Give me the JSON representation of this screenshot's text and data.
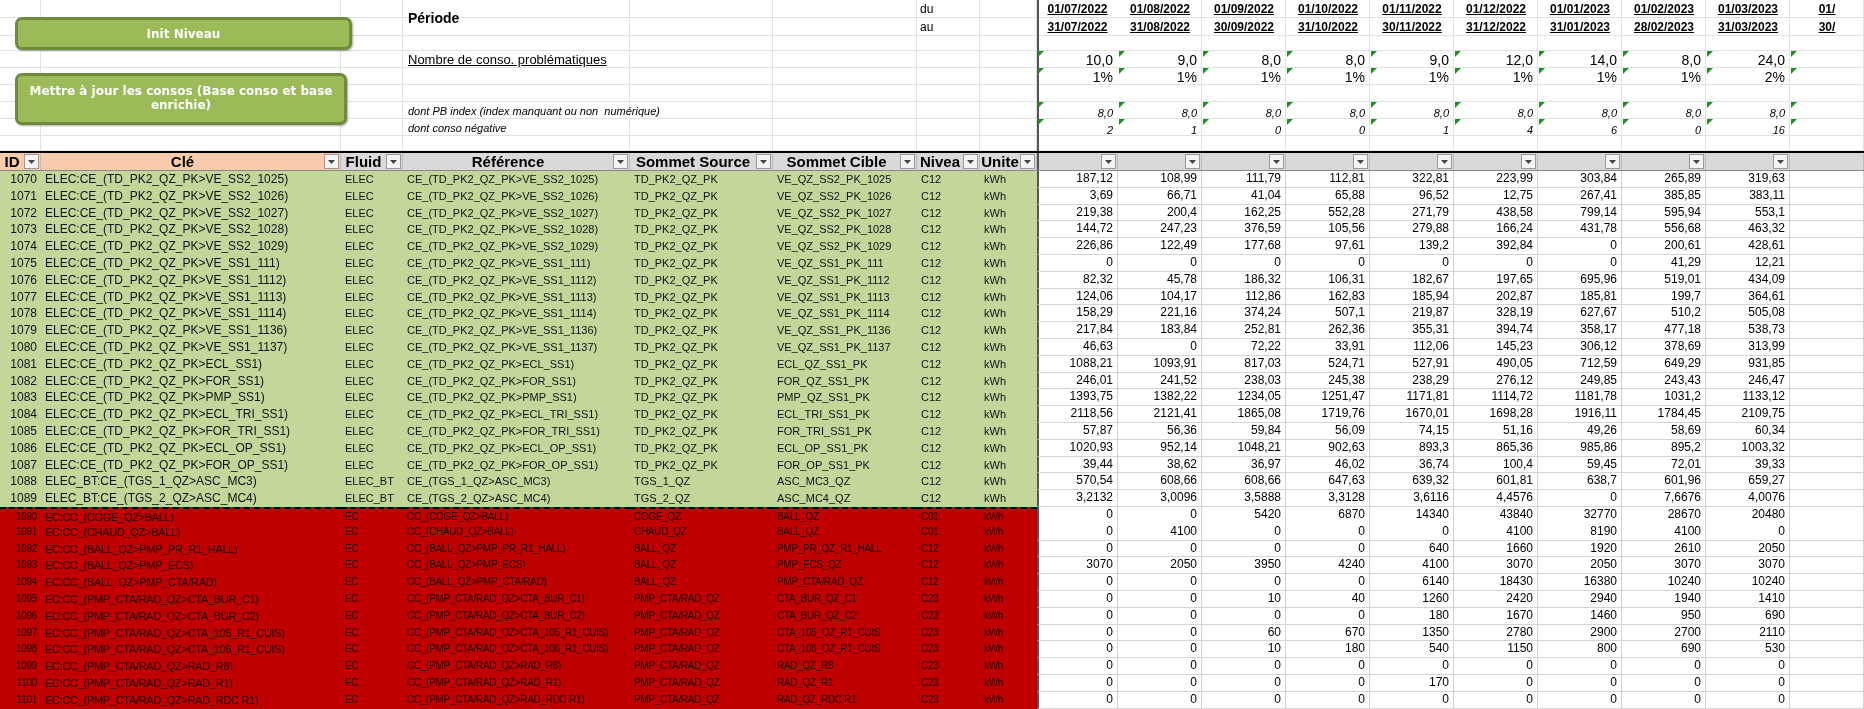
{
  "buttons": [
    {
      "label": "Init Niveau"
    },
    {
      "label": "Mettre à jour les consos (Base conso et base enrichie)"
    }
  ],
  "period": {
    "label": "Période",
    "from_label": "du",
    "to_label": "au"
  },
  "periods": [
    {
      "du": "01/07/2022",
      "au": "31/07/2022"
    },
    {
      "du": "01/08/2022",
      "au": "31/08/2022"
    },
    {
      "du": "01/09/2022",
      "au": "30/09/2022"
    },
    {
      "du": "01/10/2022",
      "au": "31/10/2022"
    },
    {
      "du": "01/11/2022",
      "au": "30/11/2022"
    },
    {
      "du": "01/12/2022",
      "au": "31/12/2022"
    },
    {
      "du": "01/01/2023",
      "au": "31/01/2023"
    },
    {
      "du": "01/02/2023",
      "au": "28/02/2023"
    },
    {
      "du": "01/03/2023",
      "au": "31/03/2023"
    },
    {
      "du": "01/",
      "au": "30/"
    }
  ],
  "summary_rows": [
    {
      "kind": "count",
      "label": "Nombre de conso. problématiques",
      "flagged": true,
      "values": [
        "10,0",
        "9,0",
        "8,0",
        "8,0",
        "9,0",
        "12,0",
        "14,0",
        "8,0",
        "24,0"
      ]
    },
    {
      "kind": "percent",
      "flagged": true,
      "values": [
        "1%",
        "1%",
        "1%",
        "1%",
        "1%",
        "1%",
        "1%",
        "1%",
        "2%"
      ]
    },
    {
      "kind": "detail",
      "label": "dont PB index (index manquant ou non  numérique)",
      "flagged": true,
      "values": [
        "8,0",
        "8,0",
        "8,0",
        "8,0",
        "8,0",
        "8,0",
        "8,0",
        "8,0",
        "8,0"
      ]
    },
    {
      "kind": "detail",
      "label": "dont conso négative",
      "flagged": true,
      "values": [
        "2",
        "1",
        "0",
        "0",
        "1",
        "4",
        "6",
        "0",
        "16"
      ]
    }
  ],
  "columns": [
    {
      "label": "ID",
      "color": "#f8cbad"
    },
    {
      "label": "Clé",
      "color": "#f8cbad"
    },
    {
      "label": "Fluid",
      "color": "#d9d9d9"
    },
    {
      "label": "Référence",
      "color": "#d9d9d9"
    },
    {
      "label": "Sommet Source",
      "color": "#d9d9d9"
    },
    {
      "label": "Sommet Cible",
      "color": "#d9d9d9"
    },
    {
      "label": "Nivea",
      "color": "#d9d9d9"
    },
    {
      "label": "Unite",
      "color": "#d9d9d9"
    }
  ],
  "row_groups": [
    {
      "color": "#c4d79b",
      "rows": [
        {
          "cells": [
            "1070",
            "ELEC:CE_(TD_PK2_QZ_PK>VE_SS2_1025)",
            "ELEC",
            "CE_(TD_PK2_QZ_PK>VE_SS2_1025)",
            "TD_PK2_QZ_PK",
            "VE_QZ_SS2_PK_1025",
            "C12",
            "kWh"
          ],
          "values": [
            "187,12",
            "108,99",
            "111,79",
            "112,81",
            "322,81",
            "223,99",
            "303,84",
            "265,89",
            "319,63"
          ]
        },
        {
          "cells": [
            "1071",
            "ELEC:CE_(TD_PK2_QZ_PK>VE_SS2_1026)",
            "ELEC",
            "CE_(TD_PK2_QZ_PK>VE_SS2_1026)",
            "TD_PK2_QZ_PK",
            "VE_QZ_SS2_PK_1026",
            "C12",
            "kWh"
          ],
          "values": [
            "3,69",
            "66,71",
            "41,04",
            "65,88",
            "96,52",
            "12,75",
            "267,41",
            "385,85",
            "383,11"
          ]
        },
        {
          "cells": [
            "1072",
            "ELEC:CE_(TD_PK2_QZ_PK>VE_SS2_1027)",
            "ELEC",
            "CE_(TD_PK2_QZ_PK>VE_SS2_1027)",
            "TD_PK2_QZ_PK",
            "VE_QZ_SS2_PK_1027",
            "C12",
            "kWh"
          ],
          "values": [
            "219,38",
            "200,4",
            "162,25",
            "552,28",
            "271,79",
            "438,58",
            "799,14",
            "595,94",
            "553,1"
          ]
        },
        {
          "cells": [
            "1073",
            "ELEC:CE_(TD_PK2_QZ_PK>VE_SS2_1028)",
            "ELEC",
            "CE_(TD_PK2_QZ_PK>VE_SS2_1028)",
            "TD_PK2_QZ_PK",
            "VE_QZ_SS2_PK_1028",
            "C12",
            "kWh"
          ],
          "values": [
            "144,72",
            "247,23",
            "376,59",
            "105,56",
            "279,88",
            "166,24",
            "431,78",
            "556,68",
            "463,32"
          ]
        },
        {
          "cells": [
            "1074",
            "ELEC:CE_(TD_PK2_QZ_PK>VE_SS2_1029)",
            "ELEC",
            "CE_(TD_PK2_QZ_PK>VE_SS2_1029)",
            "TD_PK2_QZ_PK",
            "VE_QZ_SS2_PK_1029",
            "C12",
            "kWh"
          ],
          "values": [
            "226,86",
            "122,49",
            "177,68",
            "97,61",
            "139,2",
            "392,84",
            "0",
            "200,61",
            "428,61"
          ]
        },
        {
          "cells": [
            "1075",
            "ELEC:CE_(TD_PK2_QZ_PK>VE_SS1_111)",
            "ELEC",
            "CE_(TD_PK2_QZ_PK>VE_SS1_111)",
            "TD_PK2_QZ_PK",
            "VE_QZ_SS1_PK_111",
            "C12",
            "kWh"
          ],
          "values": [
            "0",
            "0",
            "0",
            "0",
            "0",
            "0",
            "0",
            "41,29",
            "12,21"
          ]
        },
        {
          "cells": [
            "1076",
            "ELEC:CE_(TD_PK2_QZ_PK>VE_SS1_1112)",
            "ELEC",
            "CE_(TD_PK2_QZ_PK>VE_SS1_1112)",
            "TD_PK2_QZ_PK",
            "VE_QZ_SS1_PK_1112",
            "C12",
            "kWh"
          ],
          "values": [
            "82,32",
            "45,78",
            "186,32",
            "106,31",
            "182,67",
            "197,65",
            "695,96",
            "519,01",
            "434,09"
          ]
        },
        {
          "cells": [
            "1077",
            "ELEC:CE_(TD_PK2_QZ_PK>VE_SS1_1113)",
            "ELEC",
            "CE_(TD_PK2_QZ_PK>VE_SS1_1113)",
            "TD_PK2_QZ_PK",
            "VE_QZ_SS1_PK_1113",
            "C12",
            "kWh"
          ],
          "values": [
            "124,06",
            "104,17",
            "112,86",
            "162,83",
            "185,94",
            "202,87",
            "185,81",
            "199,7",
            "364,61"
          ]
        },
        {
          "cells": [
            "1078",
            "ELEC:CE_(TD_PK2_QZ_PK>VE_SS1_1114)",
            "ELEC",
            "CE_(TD_PK2_QZ_PK>VE_SS1_1114)",
            "TD_PK2_QZ_PK",
            "VE_QZ_SS1_PK_1114",
            "C12",
            "kWh"
          ],
          "values": [
            "158,29",
            "221,16",
            "374,24",
            "507,1",
            "219,87",
            "328,19",
            "627,67",
            "510,2",
            "505,08"
          ]
        },
        {
          "cells": [
            "1079",
            "ELEC:CE_(TD_PK2_QZ_PK>VE_SS1_1136)",
            "ELEC",
            "CE_(TD_PK2_QZ_PK>VE_SS1_1136)",
            "TD_PK2_QZ_PK",
            "VE_QZ_SS1_PK_1136",
            "C12",
            "kWh"
          ],
          "values": [
            "217,84",
            "183,84",
            "252,81",
            "262,36",
            "355,31",
            "394,74",
            "358,17",
            "477,18",
            "538,73"
          ]
        },
        {
          "cells": [
            "1080",
            "ELEC:CE_(TD_PK2_QZ_PK>VE_SS1_1137)",
            "ELEC",
            "CE_(TD_PK2_QZ_PK>VE_SS1_1137)",
            "TD_PK2_QZ_PK",
            "VE_QZ_SS1_PK_1137",
            "C12",
            "kWh"
          ],
          "values": [
            "46,63",
            "0",
            "72,22",
            "33,91",
            "112,06",
            "145,23",
            "306,12",
            "378,69",
            "313,99"
          ]
        },
        {
          "cells": [
            "1081",
            "ELEC:CE_(TD_PK2_QZ_PK>ECL_SS1)",
            "ELEC",
            "CE_(TD_PK2_QZ_PK>ECL_SS1)",
            "TD_PK2_QZ_PK",
            "ECL_QZ_SS1_PK",
            "C12",
            "kWh"
          ],
          "values": [
            "1088,21",
            "1093,91",
            "817,03",
            "524,71",
            "527,91",
            "490,05",
            "712,59",
            "649,29",
            "931,85"
          ]
        },
        {
          "cells": [
            "1082",
            "ELEC:CE_(TD_PK2_QZ_PK>FOR_SS1)",
            "ELEC",
            "CE_(TD_PK2_QZ_PK>FOR_SS1)",
            "TD_PK2_QZ_PK",
            "FOR_QZ_SS1_PK",
            "C12",
            "kWh"
          ],
          "values": [
            "246,01",
            "241,52",
            "238,03",
            "245,38",
            "238,29",
            "276,12",
            "249,85",
            "243,43",
            "246,47"
          ]
        },
        {
          "cells": [
            "1083",
            "ELEC:CE_(TD_PK2_QZ_PK>PMP_SS1)",
            "ELEC",
            "CE_(TD_PK2_QZ_PK>PMP_SS1)",
            "TD_PK2_QZ_PK",
            "PMP_QZ_SS1_PK",
            "C12",
            "kWh"
          ],
          "values": [
            "1393,75",
            "1382,22",
            "1234,05",
            "1251,47",
            "1171,81",
            "1114,72",
            "1181,78",
            "1031,2",
            "1133,12"
          ]
        },
        {
          "cells": [
            "1084",
            "ELEC:CE_(TD_PK2_QZ_PK>ECL_TRI_SS1)",
            "ELEC",
            "CE_(TD_PK2_QZ_PK>ECL_TRI_SS1)",
            "TD_PK2_QZ_PK",
            "ECL_TRI_SS1_PK",
            "C12",
            "kWh"
          ],
          "values": [
            "2118,56",
            "2121,41",
            "1865,08",
            "1719,76",
            "1670,01",
            "1698,28",
            "1916,11",
            "1784,45",
            "2109,75"
          ]
        },
        {
          "cells": [
            "1085",
            "ELEC:CE_(TD_PK2_QZ_PK>FOR_TRI_SS1)",
            "ELEC",
            "CE_(TD_PK2_QZ_PK>FOR_TRI_SS1)",
            "TD_PK2_QZ_PK",
            "FOR_TRI_SS1_PK",
            "C12",
            "kWh"
          ],
          "values": [
            "57,87",
            "56,36",
            "59,84",
            "56,09",
            "74,15",
            "51,16",
            "49,26",
            "58,69",
            "60,34"
          ]
        },
        {
          "cells": [
            "1086",
            "ELEC:CE_(TD_PK2_QZ_PK>ECL_OP_SS1)",
            "ELEC",
            "CE_(TD_PK2_QZ_PK>ECL_OP_SS1)",
            "TD_PK2_QZ_PK",
            "ECL_OP_SS1_PK",
            "C12",
            "kWh"
          ],
          "values": [
            "1020,93",
            "952,14",
            "1048,21",
            "902,63",
            "893,3",
            "865,36",
            "985,86",
            "895,2",
            "1003,32"
          ]
        },
        {
          "cells": [
            "1087",
            "ELEC:CE_(TD_PK2_QZ_PK>FOR_OP_SS1)",
            "ELEC",
            "CE_(TD_PK2_QZ_PK>FOR_OP_SS1)",
            "TD_PK2_QZ_PK",
            "FOR_OP_SS1_PK",
            "C12",
            "kWh"
          ],
          "values": [
            "39,44",
            "38,62",
            "36,97",
            "46,02",
            "36,74",
            "100,4",
            "59,45",
            "72,01",
            "39,33"
          ]
        },
        {
          "cells": [
            "1088",
            "ELEC_BT:CE_(TGS_1_QZ>ASC_MC3)",
            "ELEC_BT",
            "CE_(TGS_1_QZ>ASC_MC3)",
            "TGS_1_QZ",
            "ASC_MC3_QZ",
            "C12",
            "kWh"
          ],
          "values": [
            "570,54",
            "608,66",
            "608,66",
            "647,63",
            "639,32",
            "601,81",
            "638,7",
            "601,96",
            "659,27"
          ]
        },
        {
          "cells": [
            "1089",
            "ELEC_BT:CE_(TGS_2_QZ>ASC_MC4)",
            "ELEC_BT",
            "CE_(TGS_2_QZ>ASC_MC4)",
            "TGS_2_QZ",
            "ASC_MC4_QZ",
            "C12",
            "kWh"
          ],
          "values": [
            "3,2132",
            "3,0096",
            "3,5888",
            "3,3128",
            "3,6116",
            "4,4576",
            "0",
            "7,6676",
            "4,0076"
          ]
        }
      ]
    },
    {
      "color": "#c00000",
      "rows": [
        {
          "cells": [
            "1090",
            "EC:CC_(COGE_QZ>BALL)",
            "EC",
            "CC_(COGE_QZ>BALL)",
            "COGE_QZ",
            "BALL_QZ",
            "C01",
            "kWh"
          ],
          "values": [
            "0",
            "0",
            "5420",
            "6870",
            "14340",
            "43840",
            "32770",
            "28670",
            "20480"
          ]
        },
        {
          "cells": [
            "1091",
            "EC:CC_(CHAUD_QZ>BALL)",
            "EC",
            "CC_(CHAUD_QZ>BALL)",
            "CHAUD_QZ",
            "BALL_QZ",
            "C01",
            "kWh"
          ],
          "values": [
            "0",
            "4100",
            "0",
            "0",
            "0",
            "4100",
            "8190",
            "4100",
            "0"
          ]
        },
        {
          "cells": [
            "1092",
            "EC:CC_(BALL_QZ>PMP_PR_R1_HALL)",
            "EC",
            "CC_(BALL_QZ>PMP_PR_R1_HALL)",
            "BALL_QZ",
            "PMP_PR_QZ_R1_HALL",
            "C12",
            "kWh"
          ],
          "values": [
            "0",
            "0",
            "0",
            "0",
            "640",
            "1660",
            "1920",
            "2610",
            "2050"
          ]
        },
        {
          "cells": [
            "1093",
            "EC:CC_(BALL_QZ>PMP_ECS)",
            "EC",
            "CC_(BALL_QZ>PMP_ECS)",
            "BALL_QZ",
            "PMP_ECS_QZ",
            "C12",
            "kWh"
          ],
          "values": [
            "3070",
            "2050",
            "3950",
            "4240",
            "4100",
            "3070",
            "2050",
            "3070",
            "3070"
          ]
        },
        {
          "cells": [
            "1094",
            "EC:CC_(BALL_QZ>PMP_CTA/RAD)",
            "EC",
            "CC_(BALL_QZ>PMP_CTA/RAD)",
            "BALL_QZ",
            "PMP_CTA/RAD_QZ",
            "C12",
            "kWh"
          ],
          "values": [
            "0",
            "0",
            "0",
            "0",
            "6140",
            "18430",
            "16380",
            "10240",
            "10240"
          ]
        },
        {
          "cells": [
            "1095",
            "EC:CC_(PMP_CTA/RAD_QZ>CTA_BUR_C1)",
            "EC",
            "CC_(PMP_CTA/RAD_QZ>CTA_BUR_C1)",
            "PMP_CTA/RAD_QZ",
            "CTA_BUR_QZ_C1",
            "C23",
            "kWh"
          ],
          "values": [
            "0",
            "0",
            "10",
            "40",
            "1260",
            "2420",
            "2940",
            "1940",
            "1410"
          ]
        },
        {
          "cells": [
            "1096",
            "EC:CC_(PMP_CTA/RAD_QZ>CTA_BUR_C2)",
            "EC",
            "CC_(PMP_CTA/RAD_QZ>CTA_BUR_C2)",
            "PMP_CTA/RAD_QZ",
            "CTA_BUR_QZ_C2",
            "C23",
            "kWh"
          ],
          "values": [
            "0",
            "0",
            "0",
            "0",
            "180",
            "1670",
            "1460",
            "950",
            "690"
          ]
        },
        {
          "cells": [
            "1097",
            "EC:CC_(PMP_CTA/RAD_QZ>CTA_105_R1_CUIS)",
            "EC",
            "CC_(PMP_CTA/RAD_QZ>CTA_105_R1_CUIS)",
            "PMP_CTA/RAD_QZ",
            "CTA_105_QZ_R1_CUIS",
            "C23",
            "kWh"
          ],
          "values": [
            "0",
            "0",
            "60",
            "670",
            "1350",
            "2780",
            "2900",
            "2700",
            "2110"
          ]
        },
        {
          "cells": [
            "1098",
            "EC:CC_(PMP_CTA/RAD_QZ>CTA_106_R1_CUIS)",
            "EC",
            "CC_(PMP_CTA/RAD_QZ>CTA_106_R1_CUIS)",
            "PMP_CTA/RAD_QZ",
            "CTA_106_QZ_R1_CUIS",
            "C23",
            "kWh"
          ],
          "values": [
            "0",
            "0",
            "10",
            "180",
            "540",
            "1150",
            "800",
            "690",
            "530"
          ]
        },
        {
          "cells": [
            "1099",
            "EC:CC_(PMP_CTA/RAD_QZ>RAD_R8)",
            "EC",
            "CC_(PMP_CTA/RAD_QZ>RAD_R8)",
            "PMP_CTA/RAD_QZ",
            "RAD_QZ_R8",
            "C23",
            "kWh"
          ],
          "values": [
            "0",
            "0",
            "0",
            "0",
            "0",
            "0",
            "0",
            "0",
            "0"
          ]
        },
        {
          "cells": [
            "1100",
            "EC:CC_(PMP_CTA/RAD_QZ>RAD_R1)",
            "EC",
            "CC_(PMP_CTA/RAD_QZ>RAD_R1)",
            "PMP_CTA/RAD_QZ",
            "RAD_QZ_R1",
            "C23",
            "kWh"
          ],
          "values": [
            "0",
            "0",
            "0",
            "0",
            "170",
            "0",
            "0",
            "0",
            "0"
          ]
        },
        {
          "cells": [
            "1101",
            "EC:CC_(PMP_CTA/RAD_QZ>RAD_RDC R1)",
            "EC",
            "CC_(PMP_CTA/RAD_QZ>RAD_RDC R1)",
            "PMP_CTA/RAD_QZ",
            "RAD_QZ_RDC R1",
            "C23",
            "kWh"
          ],
          "values": [
            "0",
            "0",
            "0",
            "0",
            "0",
            "0",
            "0",
            "0",
            "0"
          ]
        }
      ]
    }
  ]
}
